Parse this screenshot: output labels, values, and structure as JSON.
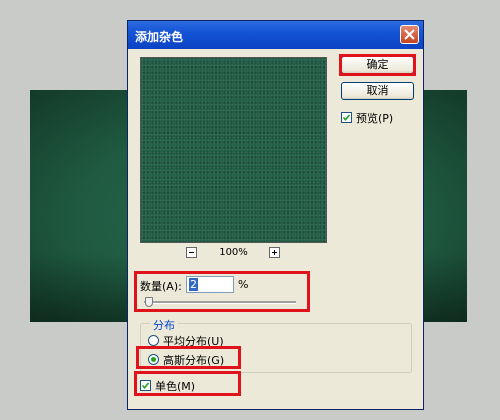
{
  "dialog": {
    "title": "添加杂色",
    "ok_label": "确定",
    "cancel_label": "取消",
    "preview_label": "预览(P)",
    "preview_checked": true,
    "zoom_level": "100%",
    "zoom_out_icon": "minus-icon",
    "zoom_in_icon": "plus-icon",
    "close_icon": "close-icon"
  },
  "amount": {
    "label": "数量(A):",
    "value": "2",
    "unit": "%",
    "slider_fraction": 0.02
  },
  "distribution": {
    "title": "分布",
    "options": [
      {
        "label": "平均分布(U)",
        "selected": false
      },
      {
        "label": "高斯分布(G)",
        "selected": true
      }
    ]
  },
  "monochrome": {
    "label": "单色(M)",
    "checked": true
  },
  "colors": {
    "titlebar": "#0b43c3",
    "highlight": "#e0121b",
    "noise_green": "#1f5c44"
  }
}
